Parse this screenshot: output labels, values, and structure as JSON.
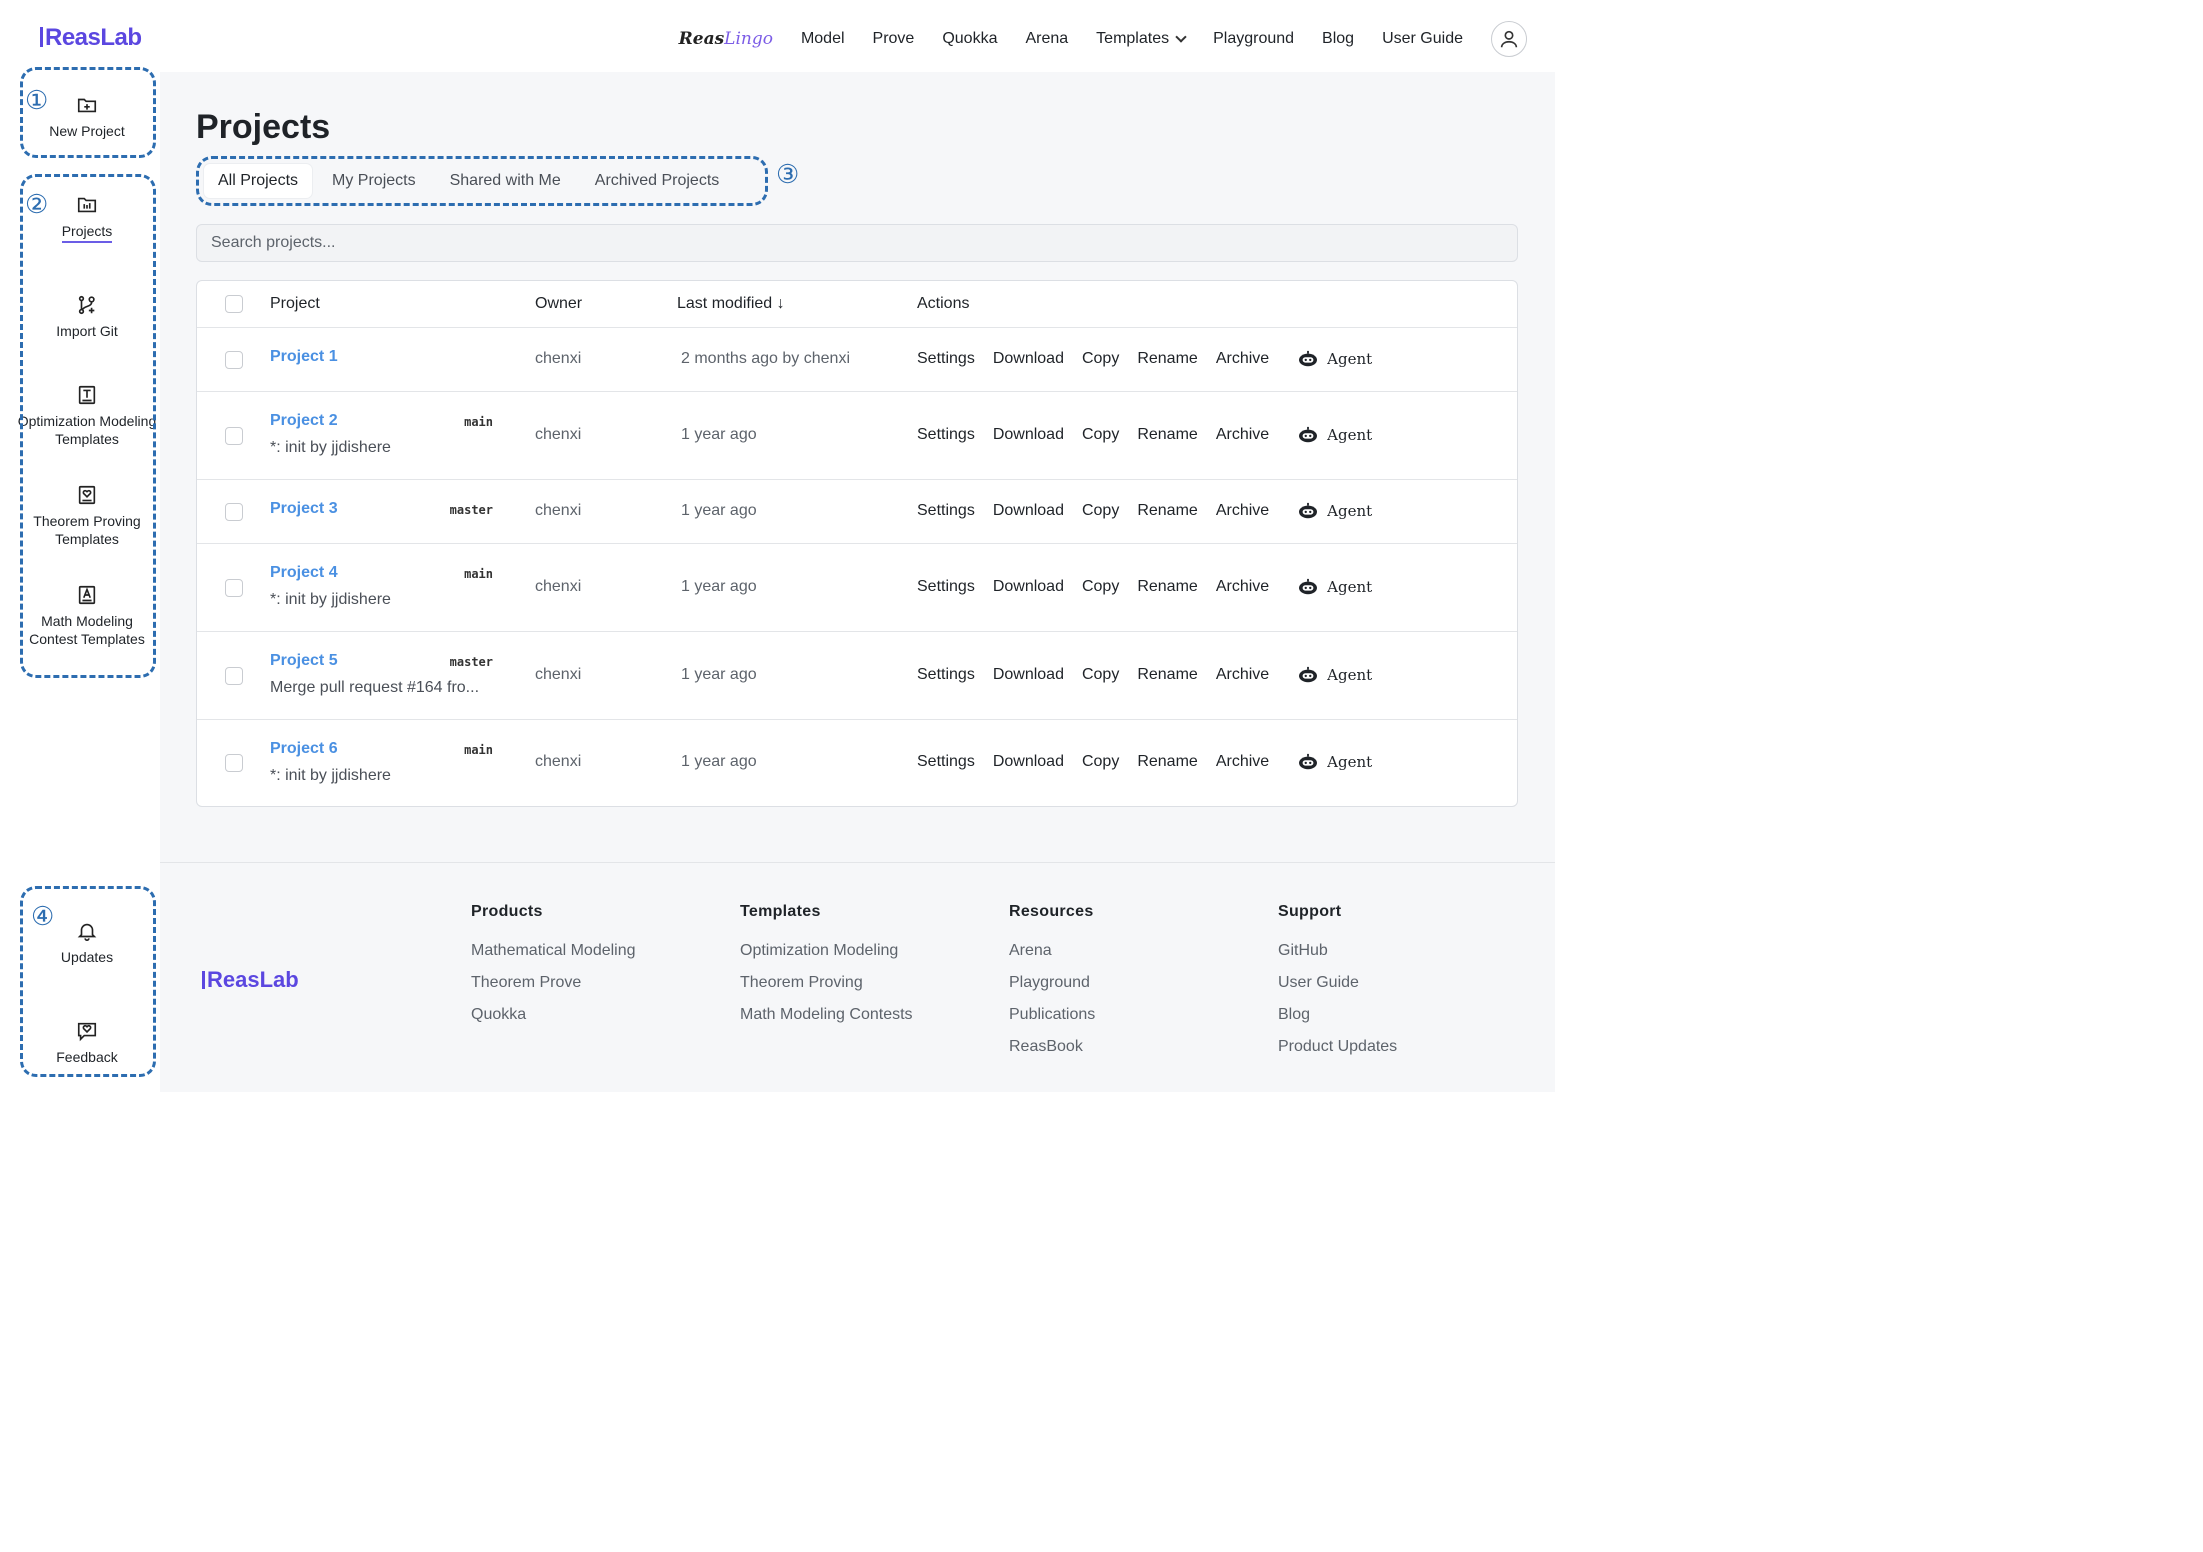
{
  "app": {
    "logo": "ReasLab",
    "brand_reas": "Reas",
    "brand_lingo": "Lingo"
  },
  "nav": {
    "items": [
      "Model",
      "Prove",
      "Quokka",
      "Arena",
      "Templates",
      "Playground",
      "Blog",
      "User Guide"
    ]
  },
  "sidebar": {
    "new_project": "New Project",
    "items": [
      {
        "label": "Projects",
        "icon": "folder-chart-icon"
      },
      {
        "label": "Import Git",
        "icon": "git-branch-plus-icon"
      },
      {
        "label": "Optimization Modeling Templates",
        "icon": "text-box-icon"
      },
      {
        "label": "Theorem Proving Templates",
        "icon": "heart-box-icon"
      },
      {
        "label": "Math Modeling Contest Templates",
        "icon": "a-box-icon"
      }
    ],
    "bottom": [
      {
        "label": "Updates",
        "icon": "bell-icon"
      },
      {
        "label": "Feedback",
        "icon": "feedback-icon"
      }
    ]
  },
  "markers": [
    "①",
    "②",
    "③",
    "④"
  ],
  "main": {
    "title": "Projects",
    "tabs": [
      "All Projects",
      "My Projects",
      "Shared with Me",
      "Archived Projects"
    ],
    "search_placeholder": "Search projects..."
  },
  "table": {
    "headers": {
      "project": "Project",
      "owner": "Owner",
      "modified": "Last modified ↓",
      "actions": "Actions"
    },
    "action_labels": [
      "Settings",
      "Download",
      "Copy",
      "Rename",
      "Archive"
    ],
    "agent_label": "Agent",
    "rows": [
      {
        "name": "Project 1",
        "branch": "",
        "commit": "",
        "owner": "chenxi",
        "modified": "2 months ago by chenxi"
      },
      {
        "name": "Project 2",
        "branch": "main",
        "commit": "*: init by jjdishere",
        "owner": "chenxi",
        "modified": "1 year ago"
      },
      {
        "name": "Project 3",
        "branch": "master",
        "commit": "",
        "owner": "chenxi",
        "modified": "1 year ago"
      },
      {
        "name": "Project 4",
        "branch": "main",
        "commit": "*: init by jjdishere",
        "owner": "chenxi",
        "modified": "1 year ago"
      },
      {
        "name": "Project 5",
        "branch": "master",
        "commit": "Merge pull request #164 fro...",
        "owner": "chenxi",
        "modified": "1 year ago"
      },
      {
        "name": "Project 6",
        "branch": "main",
        "commit": "*: init by jjdishere",
        "owner": "chenxi",
        "modified": "1 year ago"
      }
    ]
  },
  "footer": {
    "logo": "ReasLab",
    "columns": [
      {
        "heading": "Products",
        "links": [
          "Mathematical Modeling",
          "Theorem Prove",
          "Quokka"
        ]
      },
      {
        "heading": "Templates",
        "links": [
          "Optimization Modeling",
          "Theorem Proving",
          "Math Modeling Contests"
        ]
      },
      {
        "heading": "Resources",
        "links": [
          "Arena",
          "Playground",
          "Publications",
          "ReasBook"
        ]
      },
      {
        "heading": "Support",
        "links": [
          "GitHub",
          "User Guide",
          "Blog",
          "Product Updates"
        ]
      }
    ]
  }
}
